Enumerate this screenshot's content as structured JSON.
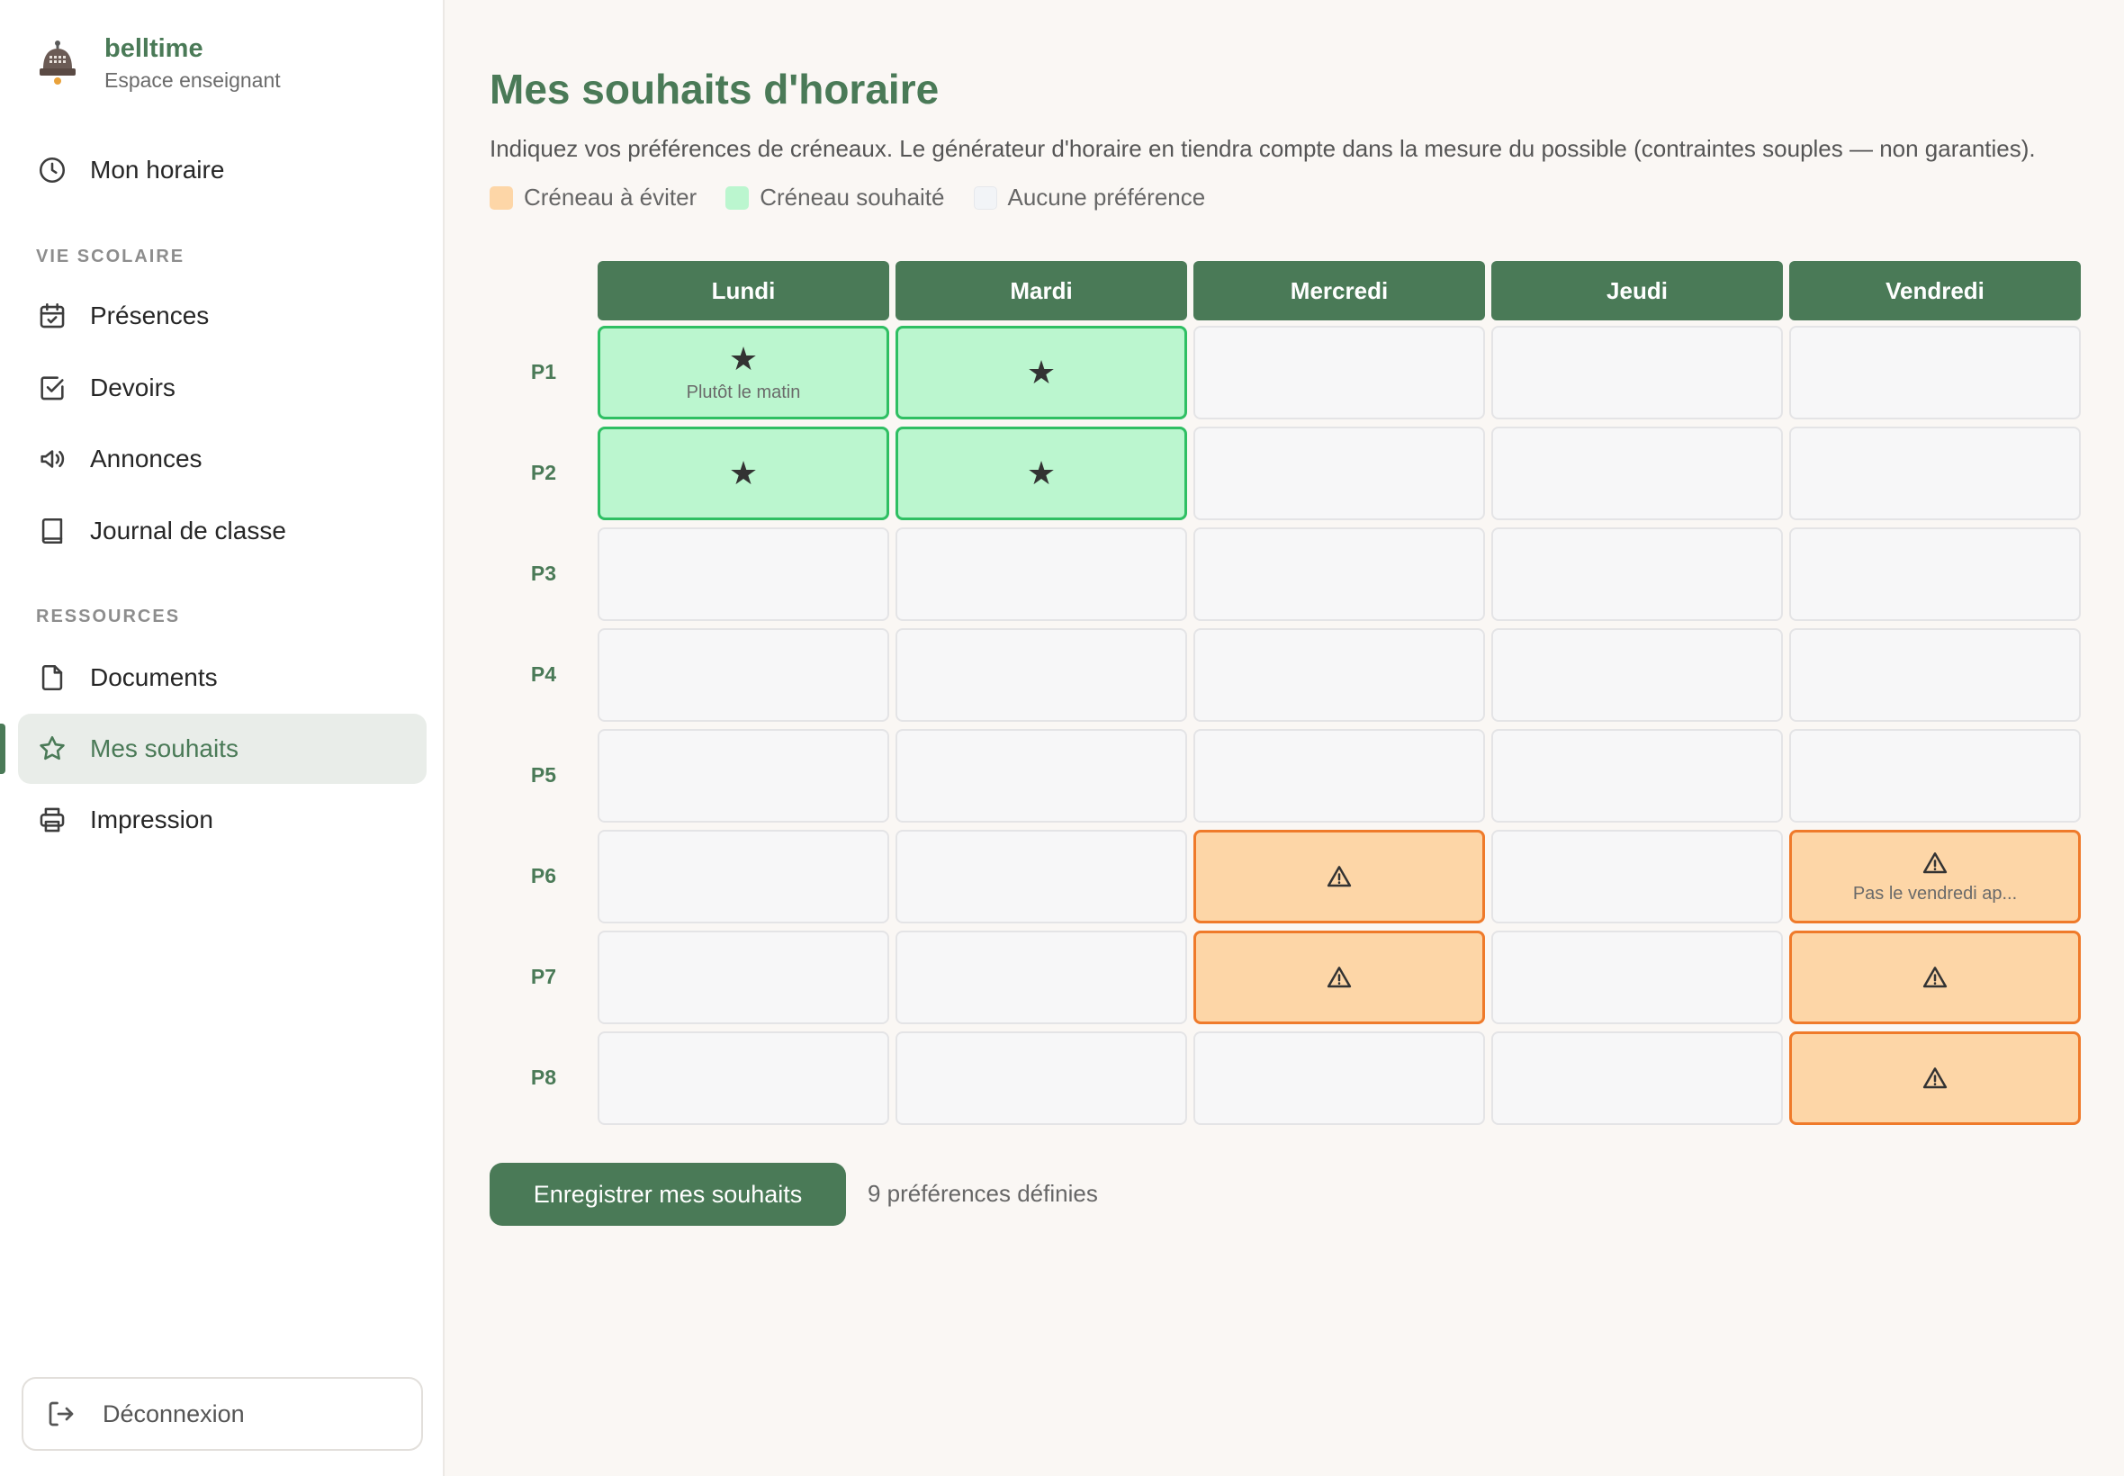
{
  "brand": {
    "name": "belltime",
    "subtitle": "Espace enseignant"
  },
  "sidebar": {
    "top_item": {
      "label": "Mon horaire",
      "icon": "clock-icon"
    },
    "sections": [
      {
        "title": "VIE SCOLAIRE",
        "items": [
          {
            "label": "Présences",
            "icon": "calendar-check-icon"
          },
          {
            "label": "Devoirs",
            "icon": "checkbox-icon"
          },
          {
            "label": "Annonces",
            "icon": "megaphone-icon"
          },
          {
            "label": "Journal de classe",
            "icon": "book-icon"
          }
        ]
      },
      {
        "title": "RESSOURCES",
        "items": [
          {
            "label": "Documents",
            "icon": "document-icon"
          },
          {
            "label": "Mes souhaits",
            "icon": "star-icon",
            "active": true
          },
          {
            "label": "Impression",
            "icon": "printer-icon"
          }
        ]
      }
    ],
    "logout_label": "Déconnexion"
  },
  "page": {
    "title": "Mes souhaits d'horaire",
    "description": "Indiquez vos préférences de créneaux. Le générateur d'horaire en tiendra compte dans la mesure du possible (contraintes souples — non garanties).",
    "legend": [
      {
        "label": "Créneau à éviter",
        "color": "#fdd6a7"
      },
      {
        "label": "Créneau souhaité",
        "color": "#bbf6cf"
      },
      {
        "label": "Aucune préférence",
        "color": "#f2f4f7"
      }
    ]
  },
  "grid": {
    "days": [
      "Lundi",
      "Mardi",
      "Mercredi",
      "Jeudi",
      "Vendredi"
    ],
    "periods": [
      "P1",
      "P2",
      "P3",
      "P4",
      "P5",
      "P6",
      "P7",
      "P8"
    ],
    "cells": [
      [
        {
          "state": "want",
          "note": "Plutôt le matin"
        },
        {
          "state": "want",
          "note": ""
        },
        {
          "state": "none",
          "note": ""
        },
        {
          "state": "none",
          "note": ""
        },
        {
          "state": "none",
          "note": ""
        }
      ],
      [
        {
          "state": "want",
          "note": ""
        },
        {
          "state": "want",
          "note": ""
        },
        {
          "state": "none",
          "note": ""
        },
        {
          "state": "none",
          "note": ""
        },
        {
          "state": "none",
          "note": ""
        }
      ],
      [
        {
          "state": "none",
          "note": ""
        },
        {
          "state": "none",
          "note": ""
        },
        {
          "state": "none",
          "note": ""
        },
        {
          "state": "none",
          "note": ""
        },
        {
          "state": "none",
          "note": ""
        }
      ],
      [
        {
          "state": "none",
          "note": ""
        },
        {
          "state": "none",
          "note": ""
        },
        {
          "state": "none",
          "note": ""
        },
        {
          "state": "none",
          "note": ""
        },
        {
          "state": "none",
          "note": ""
        }
      ],
      [
        {
          "state": "none",
          "note": ""
        },
        {
          "state": "none",
          "note": ""
        },
        {
          "state": "none",
          "note": ""
        },
        {
          "state": "none",
          "note": ""
        },
        {
          "state": "none",
          "note": ""
        }
      ],
      [
        {
          "state": "none",
          "note": ""
        },
        {
          "state": "none",
          "note": ""
        },
        {
          "state": "avoid",
          "note": ""
        },
        {
          "state": "none",
          "note": ""
        },
        {
          "state": "avoid",
          "note": "Pas le vendredi ap..."
        }
      ],
      [
        {
          "state": "none",
          "note": ""
        },
        {
          "state": "none",
          "note": ""
        },
        {
          "state": "avoid",
          "note": ""
        },
        {
          "state": "none",
          "note": ""
        },
        {
          "state": "avoid",
          "note": ""
        }
      ],
      [
        {
          "state": "none",
          "note": ""
        },
        {
          "state": "none",
          "note": ""
        },
        {
          "state": "none",
          "note": ""
        },
        {
          "state": "none",
          "note": ""
        },
        {
          "state": "avoid",
          "note": ""
        }
      ]
    ]
  },
  "footer": {
    "save_label": "Enregistrer mes souhaits",
    "count_text": "9 préférences définies"
  },
  "colors": {
    "accent": "#4a7a57",
    "want_bg": "#bbf6cf",
    "want_border": "#2fbf63",
    "avoid_bg": "#fdd6a7",
    "avoid_border": "#ef7a2a"
  }
}
